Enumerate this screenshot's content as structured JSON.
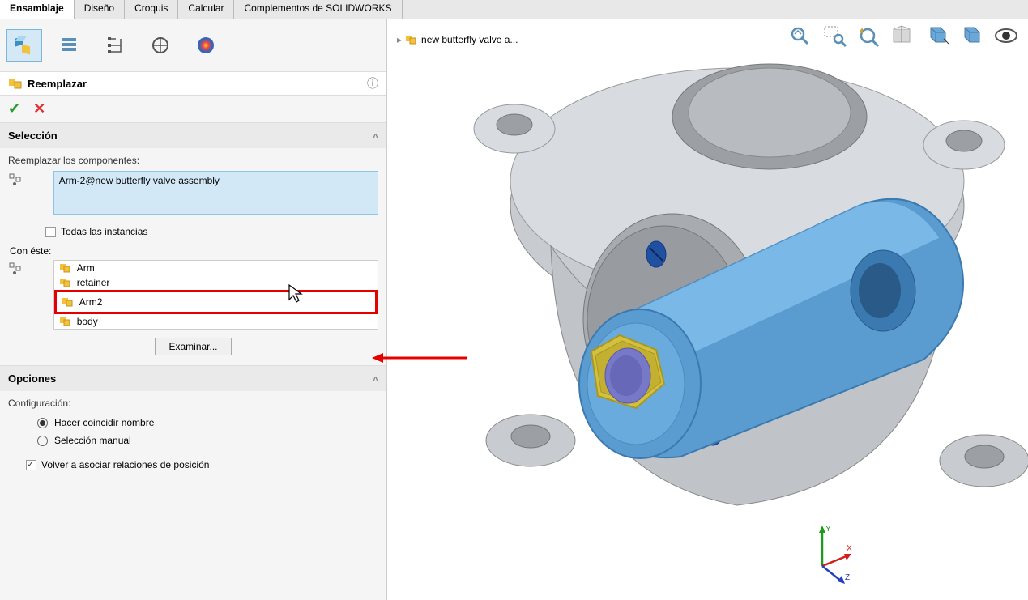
{
  "tabs": {
    "items": [
      "Ensamblaje",
      "Diseño",
      "Croquis",
      "Calcular",
      "Complementos de SOLIDWORKS"
    ],
    "active": 0
  },
  "command": {
    "title": "Reemplazar"
  },
  "selection": {
    "header": "Selección",
    "replace_label": "Reemplazar los componentes:",
    "selected_item": "Arm-2@new butterfly valve assembly",
    "all_instances": "Todas las instancias"
  },
  "with_this": {
    "label": "Con éste:",
    "items": [
      "Arm",
      "retainer",
      "Arm2",
      "body"
    ],
    "highlighted_index": 2,
    "browse": "Examinar..."
  },
  "options": {
    "header": "Opciones",
    "config_label": "Configuración:",
    "radio1": "Hacer coincidir nombre",
    "radio2": "Selección manual",
    "reassoc": "Volver a asociar relaciones de posición"
  },
  "viewport": {
    "tree_label": "new butterfly valve a..."
  },
  "triad": {
    "x": "X",
    "y": "Y",
    "z": "Z"
  }
}
